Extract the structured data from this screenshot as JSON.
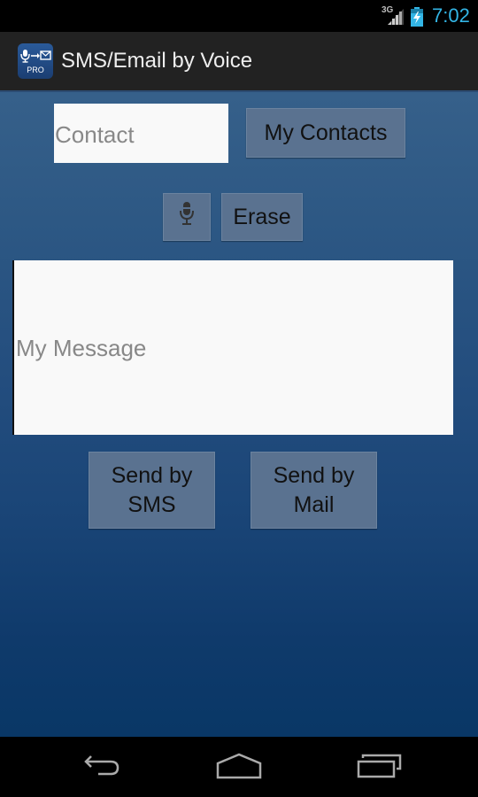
{
  "status_bar": {
    "network_type": "3G",
    "signal_icon": "signal-bars-icon",
    "battery_icon": "battery-charging-icon",
    "time": "7:02",
    "accent_color": "#33b5e5"
  },
  "action_bar": {
    "app_icon": "mic-to-mail-pro-icon",
    "app_icon_badge": "PRO",
    "title": "SMS/Email by Voice"
  },
  "form": {
    "contact": {
      "value": "",
      "placeholder": "Contact"
    },
    "my_contacts_label": "My Contacts",
    "mic_icon": "microphone-icon",
    "erase_label": "Erase",
    "message": {
      "value": "",
      "placeholder": "My Message"
    },
    "send_sms_label": "Send by SMS",
    "send_mail_label": "Send by Mail"
  },
  "nav_bar": {
    "back_icon": "back-icon",
    "home_icon": "home-icon",
    "recents_icon": "recent-apps-icon"
  },
  "colors": {
    "background_top": "#36608a",
    "background_bottom": "#093766",
    "button_bg": "#5a7290",
    "input_bg": "#f9f9f9"
  }
}
